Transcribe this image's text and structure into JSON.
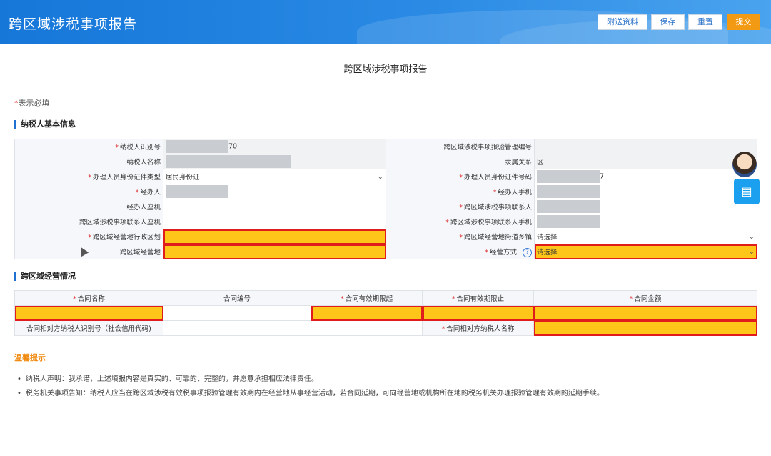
{
  "header": {
    "title": "跨区域涉税事项报告",
    "buttons": {
      "attach": "附送资料",
      "save": "保存",
      "reset": "重置",
      "submit": "提交"
    }
  },
  "page": {
    "title": "跨区域涉税事项报告",
    "required_note_star": "*",
    "required_note_text": "表示必填"
  },
  "basic": {
    "section_title": "纳税人基本信息",
    "taxpayer_id_label": "纳税人识别号",
    "taxpayer_id_value_suffix": "70",
    "report_no_label": "跨区域涉税事项报验管理编号",
    "name_label": "纳税人名称",
    "affiliation_label": "隶属关系",
    "affiliation_value": "区",
    "id_type_label": "办理人员身份证件类型",
    "id_type_value": "居民身份证",
    "id_no_label": "办理人员身份证件号码",
    "id_no_value_suffix": "7",
    "handler_label": "经办人",
    "handler_phone_label": "经办人手机",
    "handler_landline_label": "经办人座机",
    "contact_label": "跨区域涉税事项联系人",
    "contact_landline_label": "跨区域涉税事项联系人座机",
    "contact_phone_label": "跨区域涉税事项联系人手机",
    "region_label": "跨区域经营地行政区划",
    "street_label": "跨区域经营地街道乡镇",
    "street_value": "请选择",
    "address_label": "跨区域经营地",
    "mode_label": "经营方式",
    "mode_value": "请选择"
  },
  "contract": {
    "section_title": "跨区域经营情况",
    "headers": {
      "name": "合同名称",
      "number": "合同编号",
      "start": "合同有效期限起",
      "end": "合同有效期限止",
      "amount": "合同金额"
    },
    "counterparty_id_label": "合同相对方纳税人识别号（社会信用代码)",
    "counterparty_name_label": "合同相对方纳税人名称"
  },
  "tips": {
    "title": "温馨提示",
    "items": [
      "纳税人声明：我承诺，上述填报内容是真实的、可靠的、完整的，并愿意承担相应法律责任。",
      "税务机关事项告知：纳税人应当在跨区域涉税有效税事项报验管理有效期内在经营地从事经营活动，若合同延期，可向经营地或机构所在地的税务机关办理报验管理有效期的延期手续。"
    ]
  },
  "icons": {
    "chevron": "chevron-down-icon",
    "help": "help-icon",
    "search_doc": "document-search-icon"
  }
}
